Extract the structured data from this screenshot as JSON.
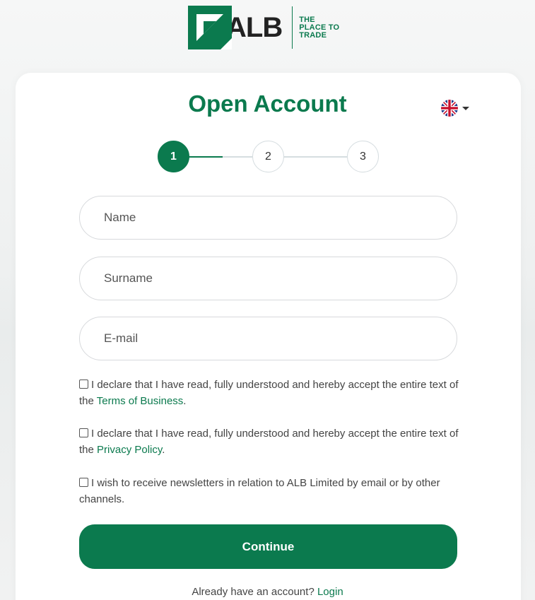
{
  "brand": {
    "logo_text": "ALB",
    "tagline": [
      "THE",
      "PLACE TO",
      "TRADE"
    ],
    "color": "#0b7a4e"
  },
  "form": {
    "title": "Open Account",
    "language_icon": "uk-flag-icon",
    "steps": [
      "1",
      "2",
      "3"
    ],
    "active_step": 1,
    "fields": {
      "name_placeholder": "Name",
      "surname_placeholder": "Surname",
      "email_placeholder": "E-mail"
    },
    "checkboxes": {
      "terms_text": "I declare that I have read, fully understood and hereby accept the entire text of the ",
      "terms_link": "Terms of Business",
      "privacy_text": "I declare that I have read, fully understood and hereby accept the entire text of the ",
      "privacy_link": "Privacy Policy",
      "newsletter_text": "I wish to receive newsletters in relation to ALB Limited by email or by other channels."
    },
    "continue_label": "Continue",
    "login_prompt": "Already have an account?",
    "login_link": "Login"
  }
}
